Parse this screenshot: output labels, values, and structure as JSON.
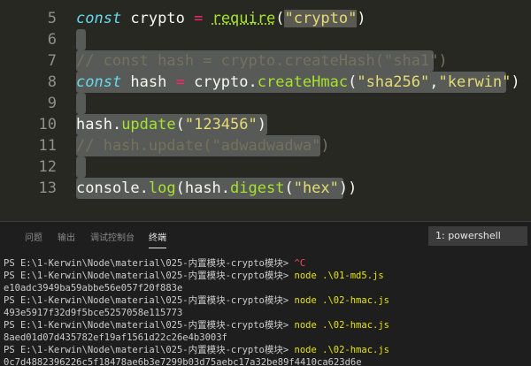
{
  "editor": {
    "lines": [
      {
        "num": "5"
      },
      {
        "num": "6"
      },
      {
        "num": "7"
      },
      {
        "num": "8"
      },
      {
        "num": "9"
      },
      {
        "num": "10"
      },
      {
        "num": "11"
      },
      {
        "num": "12"
      },
      {
        "num": "13"
      }
    ],
    "tokens": {
      "l5_const": "const",
      "l5_name": " crypto ",
      "l5_eq": "=",
      "l5_sp": " ",
      "l5_require": "require",
      "l5_open": "(",
      "l5_str": "\"crypto\"",
      "l5_close": ")",
      "l7_comment": "// const hash = crypto.createHash(\"sha1\")",
      "l8_const": "const",
      "l8_name": " hash ",
      "l8_eq": "=",
      "l8_obj": " crypto.",
      "l8_fn": "createHmac",
      "l8_open": "(",
      "l8_str1": "\"sha256\"",
      "l8_comma": ",",
      "l8_str2": "\"kerwin\"",
      "l8_close": ")",
      "l10_obj": "hash.",
      "l10_fn": "update",
      "l10_open": "(",
      "l10_str": "\"123456\"",
      "l10_close": ")",
      "l11_comment": "// hash.update(\"adwadwadwa\")",
      "l13_obj": "console.",
      "l13_fn": "log",
      "l13_open": "(hash.",
      "l13_fn2": "digest",
      "l13_open2": "(",
      "l13_str": "\"hex\"",
      "l13_close": "))"
    }
  },
  "panel": {
    "tabs": [
      "问题",
      "输出",
      "调试控制台",
      "终端"
    ],
    "active_tab": "终端",
    "terminal_select": "1: powershell"
  },
  "terminal": {
    "prompt": "PS E:\\1-Kerwin\\Node\\material\\025-内置模块-crypto模块> ",
    "lines": [
      {
        "ctrl": "^C"
      },
      {
        "cmd": "node .\\01-md5.js"
      },
      {
        "out": "e10adc3949ba59abbe56e057f20f883e"
      },
      {
        "cmd": "node .\\02-hmac.js"
      },
      {
        "out": "493e5917f32d9f5bce5257058e115773"
      },
      {
        "cmd": "node .\\02-hmac.js"
      },
      {
        "out": "8aed01d07d435782ef19af1561d22c26e4b3003f"
      },
      {
        "cmd": "node .\\02-hmac.js"
      },
      {
        "out": "0c7d4882396226c5f18478ae6b3e7299b03d75aebc17a32be89f4410ca623d6e"
      }
    ]
  },
  "colors": {
    "editor_bg": "#272822",
    "selection": "#575a57",
    "keyword": "#66d9ef",
    "operator": "#f92672",
    "function": "#a6e22e",
    "string": "#e6db74",
    "comment": "#75715e",
    "terminal_cmd": "#e5e510",
    "terminal_ctrl": "#f14c4c"
  }
}
